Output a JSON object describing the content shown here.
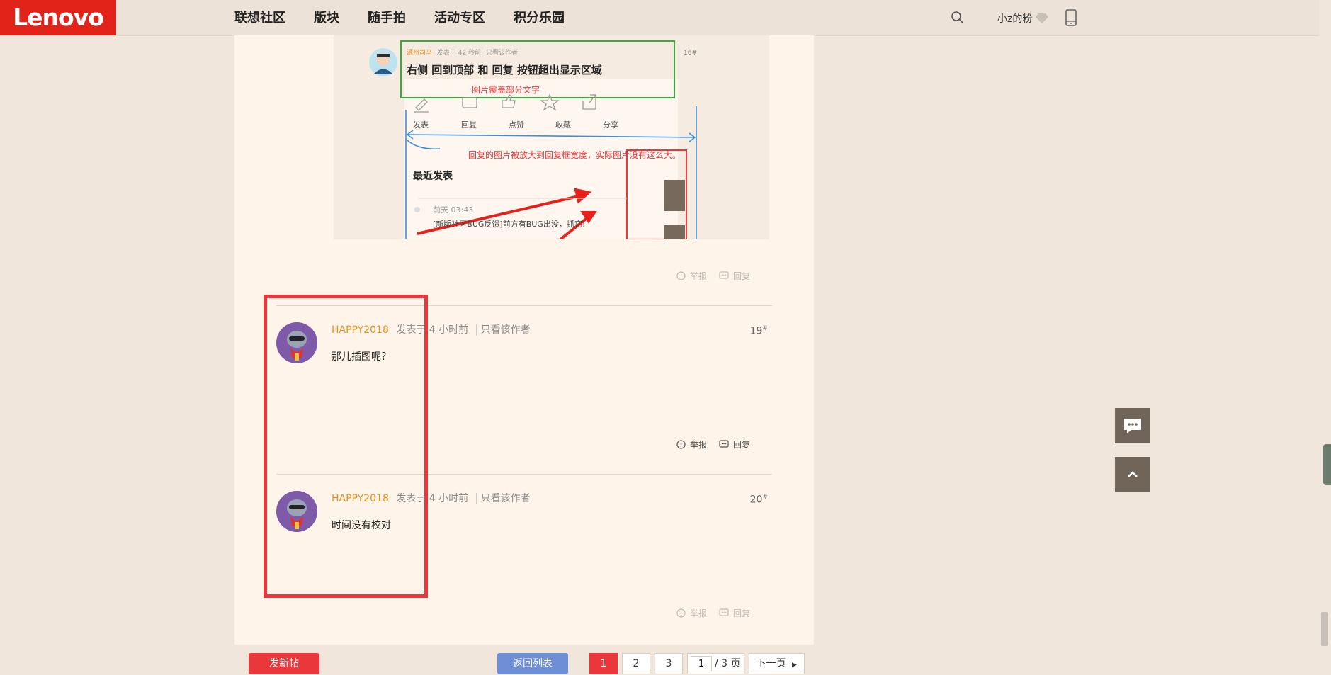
{
  "logo": "Lenovo",
  "nav": [
    "联想社区",
    "版块",
    "随手拍",
    "活动专区",
    "积分乐园"
  ],
  "user": {
    "name": "小z的粉"
  },
  "embedded_image": {
    "author": "源州司马",
    "time": "发表于 42 秒前",
    "only_author": "只看该作者",
    "floor": "16#",
    "title": "右侧 回到顶部 和 回复 按钮超出显示区域",
    "note_green": "图片覆盖部分文字",
    "toolbar": [
      "发表",
      "回复",
      "点赞",
      "收藏",
      "分享"
    ],
    "note_red": "回复的图片被放大到回复框宽度，实际图片没有这么大。",
    "recent_heading": "最近发表",
    "recent_time": "前天 03:43",
    "recent_text": "[新版社区BUG反馈]前方有BUG出没，抓它!"
  },
  "actions": {
    "report": "举报",
    "reply": "回复"
  },
  "posts": [
    {
      "author": "HAPPY2018",
      "time": "发表于 4 小时前",
      "only_author": "只看该作者",
      "floor": "19",
      "body": "那儿插图呢？"
    },
    {
      "author": "HAPPY2018",
      "time": "发表于 4 小时前",
      "only_author": "只看该作者",
      "floor": "20",
      "body": "时间没有校对"
    }
  ],
  "bottom": {
    "new_post": "发新帖",
    "back_list": "返回列表",
    "pages": [
      "1",
      "2",
      "3"
    ],
    "current_page": "1",
    "page_input": "1",
    "total": "/ 3 页",
    "next": "下一页"
  },
  "colors": {
    "brand": "#e2231a",
    "author": "#e8901e",
    "highlight": "#e9373c"
  }
}
